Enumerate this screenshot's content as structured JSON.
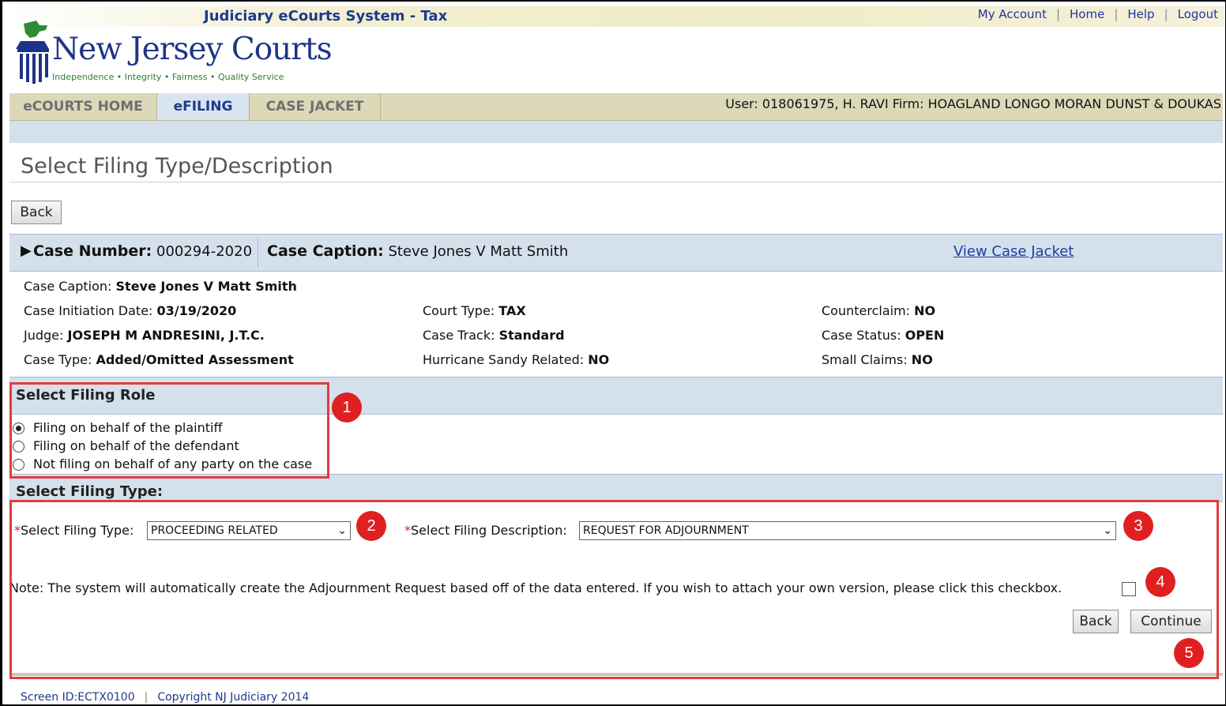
{
  "system_title": "Judiciary eCourts System - Tax",
  "top_links": [
    "My Account",
    "Home",
    "Help",
    "Logout"
  ],
  "brand": {
    "name": "New Jersey Courts",
    "tagline": "Independence • Integrity • Fairness • Quality Service"
  },
  "tabs": [
    {
      "label": "eCOURTS HOME",
      "active": false
    },
    {
      "label": "eFILING",
      "active": true
    },
    {
      "label": "CASE JACKET",
      "active": false
    }
  ],
  "user_info": "User: 018061975, H. RAVI  Firm: HOAGLAND LONGO MORAN DUNST & DOUKAS",
  "page_title": "Select Filing Type/Description",
  "back_label": "Back",
  "case_bar": {
    "case_number_label": "Case Number:",
    "case_number": "000294-2020",
    "case_caption_label": "Case Caption:",
    "case_caption": "Steve Jones V Matt Smith",
    "view_link": "View Case Jacket"
  },
  "details": {
    "caption_label": "Case Caption:",
    "caption_value": "Steve Jones V Matt Smith",
    "initiation_label": "Case Initiation Date:",
    "initiation_value": "03/19/2020",
    "judge_label": "Judge:",
    "judge_value": "JOSEPH M ANDRESINI, J.T.C.",
    "case_type_label": "Case Type:",
    "case_type_value": "Added/Omitted Assessment",
    "court_type_label": "Court Type:",
    "court_type_value": "TAX",
    "track_label": "Case Track:",
    "track_value": "Standard",
    "sandy_label": "Hurricane Sandy Related:",
    "sandy_value": "NO",
    "counterclaim_label": "Counterclaim:",
    "counterclaim_value": "NO",
    "status_label": "Case Status:",
    "status_value": "OPEN",
    "small_claims_label": "Small Claims:",
    "small_claims_value": "NO"
  },
  "filing_role": {
    "title": "Select Filing Role",
    "options": [
      {
        "label": "Filing on behalf of the plaintiff",
        "selected": true
      },
      {
        "label": "Filing on behalf of the defendant",
        "selected": false
      },
      {
        "label": "Not filing on behalf of any party on the case",
        "selected": false
      }
    ]
  },
  "filing_type": {
    "title": "Select Filing Type:",
    "required_mark": "*",
    "type_label": "Select Filing Type:",
    "type_value": "PROCEEDING RELATED",
    "desc_label": "Select Filing Description:",
    "desc_value": "REQUEST FOR ADJOURNMENT",
    "note": "Note: The system will automatically create the Adjournment Request based off of the data entered. If you wish to attach your own version, please click this checkbox.",
    "back_label": "Back",
    "continue_label": "Continue"
  },
  "callouts": [
    "1",
    "2",
    "3",
    "4",
    "5"
  ],
  "annotation_color": "#e03d3d",
  "footer": {
    "screen_id": "Screen ID:ECTX0100",
    "copyright": "Copyright NJ Judiciary 2014"
  }
}
